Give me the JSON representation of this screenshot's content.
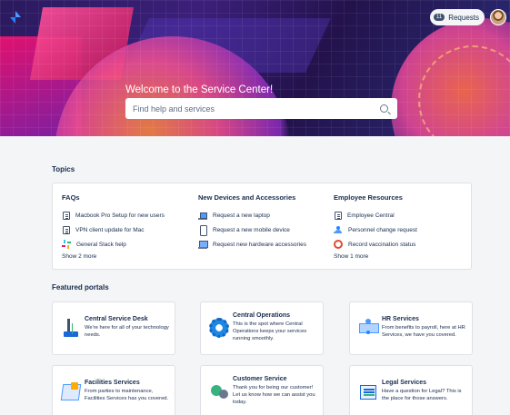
{
  "header": {
    "requests_label": "Requests",
    "requests_badge": "11"
  },
  "hero": {
    "welcome": "Welcome to the Service Center!",
    "search_placeholder": "Find help and services"
  },
  "topics": {
    "title": "Topics",
    "columns": [
      {
        "heading": "FAQs",
        "items": [
          {
            "label": "Macbook Pro Setup for new users",
            "icon": "document-icon"
          },
          {
            "label": "VPN client update for Mac",
            "icon": "document-icon"
          },
          {
            "label": "General Slack help",
            "icon": "slack-icon"
          }
        ],
        "show_more": "Show 2 more"
      },
      {
        "heading": "New Devices and Accessories",
        "items": [
          {
            "label": "Request a new laptop",
            "icon": "laptop-icon"
          },
          {
            "label": "Request a new mobile device",
            "icon": "phone-icon"
          },
          {
            "label": "Request new hardware accessories",
            "icon": "hardware-icon"
          }
        ],
        "show_more": ""
      },
      {
        "heading": "Employee Resources",
        "items": [
          {
            "label": "Employee Central",
            "icon": "document-icon"
          },
          {
            "label": "Personnel change request",
            "icon": "person-icon"
          },
          {
            "label": "Record vaccination status",
            "icon": "record-icon"
          }
        ],
        "show_more": "Show 1 more"
      }
    ]
  },
  "portals": {
    "title": "Featured portals",
    "items": [
      {
        "name": "Central Service Desk",
        "desc": "We're here for all of your technology needs.",
        "icon": "desk-icon"
      },
      {
        "name": "Central Operations",
        "desc": "This is the spot where Central Operations keeps your services running smoothly.",
        "icon": "gear-icon"
      },
      {
        "name": "HR Services",
        "desc": "From benefits to payroll, here at HR Services, we have you covered.",
        "icon": "people-icon"
      },
      {
        "name": "Facilities Services",
        "desc": "From parties to maintenance, Facilities Services has you covered.",
        "icon": "building-icon"
      },
      {
        "name": "Customer Service",
        "desc": "Thank you for being our customer! Let us know how we can assist you today.",
        "icon": "chat-icon"
      },
      {
        "name": "Legal Services",
        "desc": "Have a question for Legal? This is the place for those answers.",
        "icon": "legal-doc-icon"
      }
    ]
  }
}
